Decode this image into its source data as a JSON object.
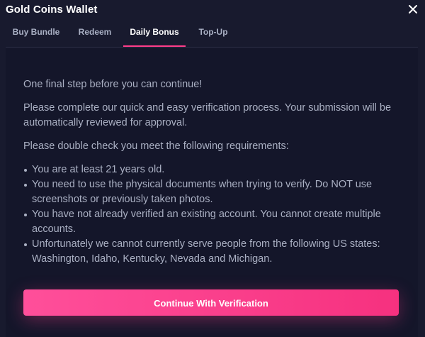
{
  "window": {
    "title": "Gold Coins Wallet",
    "close_icon": "close-icon"
  },
  "tabs": [
    {
      "label": "Buy Bundle",
      "active": false
    },
    {
      "label": "Redeem",
      "active": false
    },
    {
      "label": "Daily Bonus",
      "active": true
    },
    {
      "label": "Top-Up",
      "active": false
    }
  ],
  "content": {
    "intro": "One final step before you can continue!",
    "instruction": "Please complete our quick and easy verification process. Your submission will be automatically reviewed for approval.",
    "requirements_heading": "Please double check you meet the following requirements:",
    "requirements": [
      "You are at least 21 years old.",
      "You need to use the physical documents when trying to verify. Do NOT use screenshots or previously taken photos.",
      "You have not already verified an existing account. You cannot create multiple accounts.",
      "Unfortunately we cannot currently serve people from the following US states: Washington, Idaho, Kentucky, Nevada and Michigan."
    ]
  },
  "actions": {
    "continue_label": "Continue With Verification"
  },
  "colors": {
    "accent": "#ff3d8a",
    "background": "#181a2e",
    "text_muted": "#aab0c3"
  }
}
